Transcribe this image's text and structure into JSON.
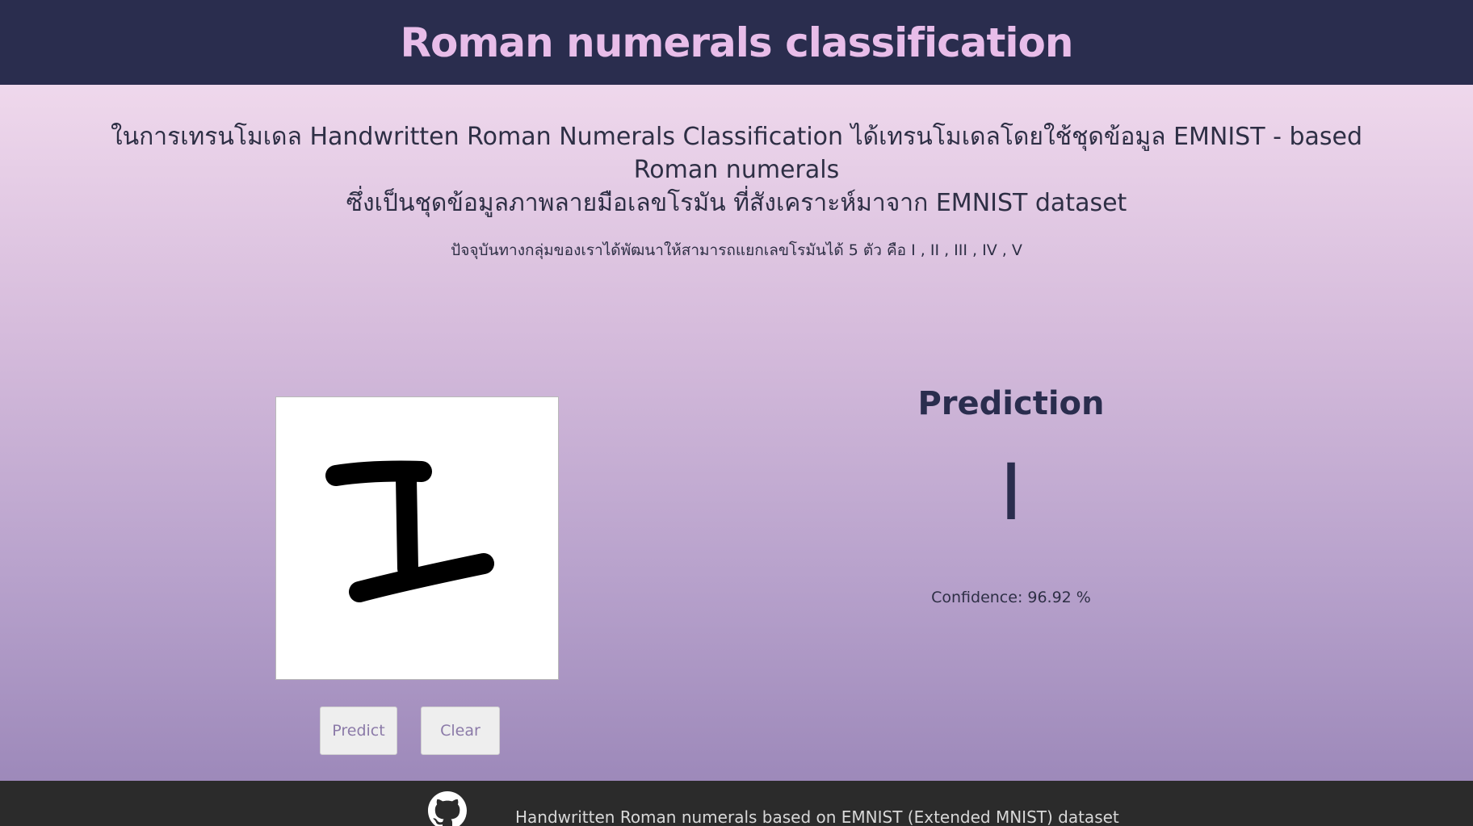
{
  "header": {
    "title": "Roman numerals classification"
  },
  "intro": {
    "line1": "ในการเทรนโมเดล Handwritten Roman Numerals Classification ได้เทรนโมเดลโดยใช้ชุดข้อมูล EMNIST - based Roman numerals",
    "line2": "ซึ่งเป็นชุดข้อมูลภาพลายมือเลขโรมัน ที่สังเคราะห์มาจาก EMNIST dataset",
    "subtitle": "ปัจจุบันทางกลุ่มของเราได้พัฒนาให้สามารถแยกเลขโรมันได้ 5 ตัว คือ I , II , III , IV , V"
  },
  "canvas": {
    "drawn_glyph": "I"
  },
  "buttons": {
    "predict": "Predict",
    "clear": "Clear"
  },
  "prediction": {
    "title": "Prediction",
    "value": "I",
    "confidence": "Confidence: 96.92 %"
  },
  "footer": {
    "icon": "github-icon",
    "text": "Handwritten Roman numerals based on EMNIST (Extended MNIST) dataset"
  },
  "colors": {
    "header_bg": "#2a2d4e",
    "title": "#e8bde9",
    "footer_bg": "#2b2b2b"
  }
}
